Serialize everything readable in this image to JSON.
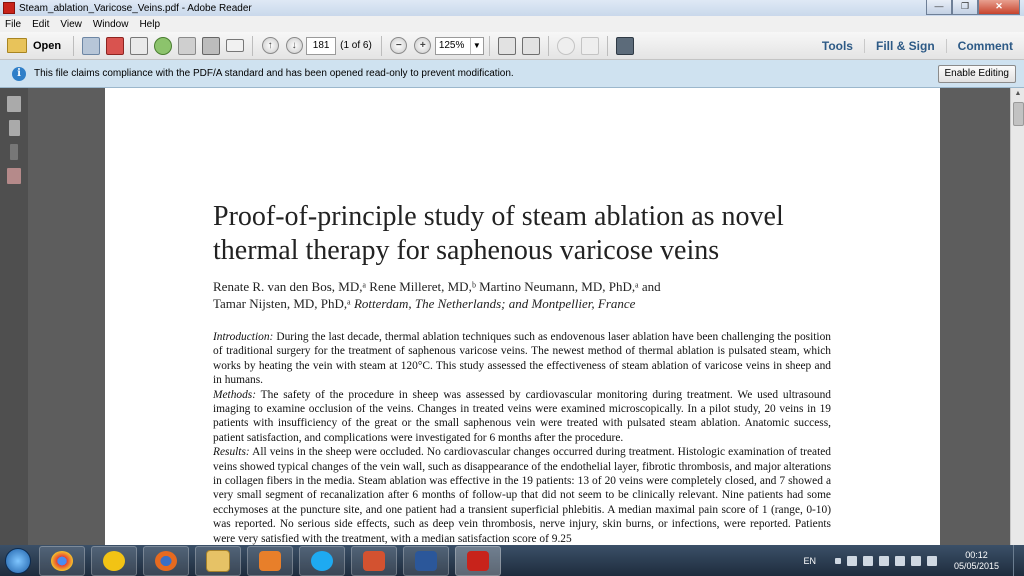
{
  "window": {
    "title": "Steam_ablation_Varicose_Veins.pdf - Adobe Reader"
  },
  "menu": [
    "File",
    "Edit",
    "View",
    "Window",
    "Help"
  ],
  "toolbar": {
    "open_label": "Open",
    "page_number": "181",
    "page_count": "(1 of 6)",
    "zoom": "125%",
    "right": [
      "Tools",
      "Fill & Sign",
      "Comment"
    ]
  },
  "notice": {
    "text": "This file claims compliance with the PDF/A standard and has been opened read-only to prevent modification.",
    "button": "Enable Editing"
  },
  "document": {
    "title": "Proof-of-principle study of steam ablation as novel thermal therapy for saphenous varicose veins",
    "authors_line1": "Renate R. van den Bos, MD,ᵃ Rene Milleret, MD,ᵇ Martino Neumann, MD, PhD,ᵃ and",
    "authors_line2": "Tamar Nijsten, MD, PhD,ᵃ",
    "affiliation": "Rotterdam, The Netherlands; and Montpellier, France",
    "intro_label": "Introduction:",
    "intro_text": " During the last decade, thermal ablation techniques such as endovenous laser ablation have been challenging the position of traditional surgery for the treatment of saphenous varicose veins. The newest method of thermal ablation is pulsated steam, which works by heating the vein with steam at 120°C. This study assessed the effectiveness of steam ablation of varicose veins in sheep and in humans.",
    "methods_label": "Methods:",
    "methods_text": " The safety of the procedure in sheep was assessed by cardiovascular monitoring during treatment. We used ultrasound imaging to examine occlusion of the veins. Changes in treated veins were examined microscopically. In a pilot study, 20 veins in 19 patients with insufficiency of the great or the small saphenous vein were treated with pulsated steam ablation. Anatomic success, patient satisfaction, and complications were investigated for 6 months after the procedure.",
    "results_label": "Results:",
    "results_text": " All veins in the sheep were occluded. No cardiovascular changes occurred during treatment. Histologic examination of treated veins showed typical changes of the vein wall, such as disappearance of the endothelial layer, fibrotic thrombosis, and major alterations in collagen fibers in the media. Steam ablation was effective in the 19 patients: 13 of 20 veins were completely closed, and 7 showed a very small segment of recanalization after 6 months of follow-up that did not seem to be clinically relevant. Nine patients had some ecchymoses at the puncture site, and one patient had a transient superficial phlebitis. A median maximal pain score of 1 (range, 0-10) was reported. No serious side effects, such as deep vein thrombosis, nerve injury, skin burns, or infections, were reported. Patients were very satisfied with the treatment, with a median satisfaction score of 9.25"
  },
  "taskbar": {
    "apps": [
      "chrome",
      "norton",
      "firefox",
      "explorer",
      "media-player",
      "skype",
      "powerpoint",
      "word",
      "acrobat"
    ],
    "language": "EN",
    "time": "00:12",
    "date": "05/05/2015"
  },
  "colors": {
    "accent": "#2d5a86",
    "notice_bg": "#cfe2f0",
    "reader_red": "#c8231b"
  }
}
